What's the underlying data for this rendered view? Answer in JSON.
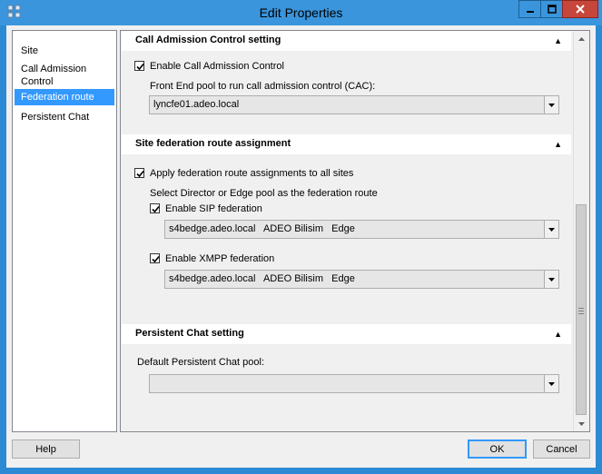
{
  "window": {
    "title": "Edit Properties"
  },
  "nav": {
    "items": [
      {
        "label": "Site"
      },
      {
        "label": "Call Admission\nControl"
      },
      {
        "label": "Federation route"
      },
      {
        "label": "Persistent Chat"
      }
    ],
    "selected_index": 2
  },
  "sections": {
    "cac": {
      "title": "Call Admission Control setting",
      "enable_label": "Enable Call Admission Control",
      "enable_checked": true,
      "pool_label": "Front End pool to run call admission control (CAC):",
      "pool_value": "lyncfe01.adeo.local"
    },
    "federation": {
      "title": "Site federation route assignment",
      "apply_label": "Apply federation route assignments to all sites",
      "apply_checked": true,
      "select_label": "Select Director or Edge pool as the federation route",
      "sip_label": "Enable SIP federation",
      "sip_checked": true,
      "sip_value": "s4bedge.adeo.local   ADEO Bilisim   Edge",
      "xmpp_label": "Enable XMPP federation",
      "xmpp_checked": true,
      "xmpp_value": "s4bedge.adeo.local   ADEO Bilisim   Edge"
    },
    "pchat": {
      "title": "Persistent Chat setting",
      "pool_label": "Default Persistent Chat pool:",
      "pool_value": ""
    }
  },
  "buttons": {
    "help": "Help",
    "ok": "OK",
    "cancel": "Cancel"
  },
  "colors": {
    "titlebar": "#3a95dc",
    "selection": "#3399ff",
    "close": "#c7463c"
  },
  "icons": {
    "app": "app-icon",
    "minimize": "minimize-icon",
    "maximize": "maximize-icon",
    "close": "close-icon"
  }
}
